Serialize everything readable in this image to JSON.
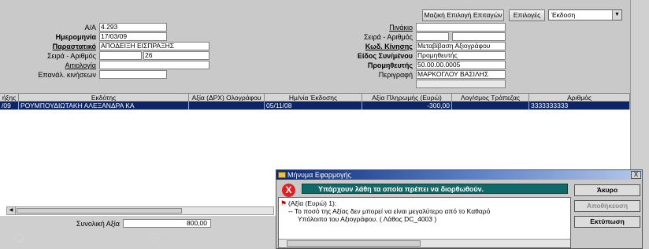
{
  "toolbar": {
    "mass_select_label": "Μαζική Επιλογή Επιταγών",
    "options_label": "Επιλογές",
    "issue_select_value": "Έκδοση"
  },
  "left_form": {
    "aa_label": "Α/Α",
    "aa_value": "4.293",
    "date_label": "Ημερομηνία",
    "date_value": "17/03/09",
    "voucher_label": "Παραστατικό",
    "voucher_value": "ΑΠΟΔΕΙΞΗ ΕΙΣΠΡΑΞΗΣ",
    "series_label": "Σειρά - Αριθμός",
    "series_number": "26",
    "reason_label": "Αιτιολογία",
    "repeat_label": "Επανάλ. κινήσεων"
  },
  "right_form": {
    "table_label": "Πινάκιο",
    "series_label": "Σειρά - Αριθμός",
    "move_code_label": "Κωδ. Κίνησης",
    "move_code_value": "Μεταβίβαση Αξιογράφου",
    "partner_type_label": "Είδος Συν/μένου",
    "partner_type_value": "Προμηθευτής",
    "supplier_label": "Προμηθευτής",
    "supplier_value": "50.00.00.0005",
    "description_label": "Περιγραφή",
    "description_value": "ΜΑΡΚΟΓΛΟΥ ΒΑΣΙΛΗΣ"
  },
  "grid": {
    "headers": [
      "ήξης",
      "Εκδότης",
      "Αξία (ΔΡΧ) Ολογράφου",
      "Ημ/νία Έκδοσης",
      "Αξία Πληρωμής (Ευρώ)",
      "Λογ/σμος Τράπεζας",
      "Αριθμός"
    ],
    "row": [
      "/09",
      "ΡΟΥΜΠΟΥΔΙΩΤΑΚΗ ΑΛΕΞΑΝΔΡΑ ΚΑ",
      "",
      "05/11/08",
      "-300,00",
      "",
      "3333333333"
    ]
  },
  "footer": {
    "total_label": "Συνολική Αξία",
    "total_value": "800,00"
  },
  "dialog": {
    "title": "Μήνυμα Εφαρμογής",
    "close_glyph": "X",
    "error_glyph": "X",
    "banner": "Υπάρχουν λάθη τα οποία πρέπει να διορθωθούν.",
    "cancel_label": "Άκυρο",
    "save_label": "Αποθήκευση",
    "print_label": "Εκτύπωση",
    "msg_line1": "(Αξία (Ευρώ) 1):",
    "msg_line2": "-- Το ποσό της Αξίας δεν μπορεί να είναι μεγαλύτερο από το Καθαρό",
    "msg_line3": "Υπόλοιπο του Αξιογράφου. ( Λάθος DC_4003 )"
  }
}
